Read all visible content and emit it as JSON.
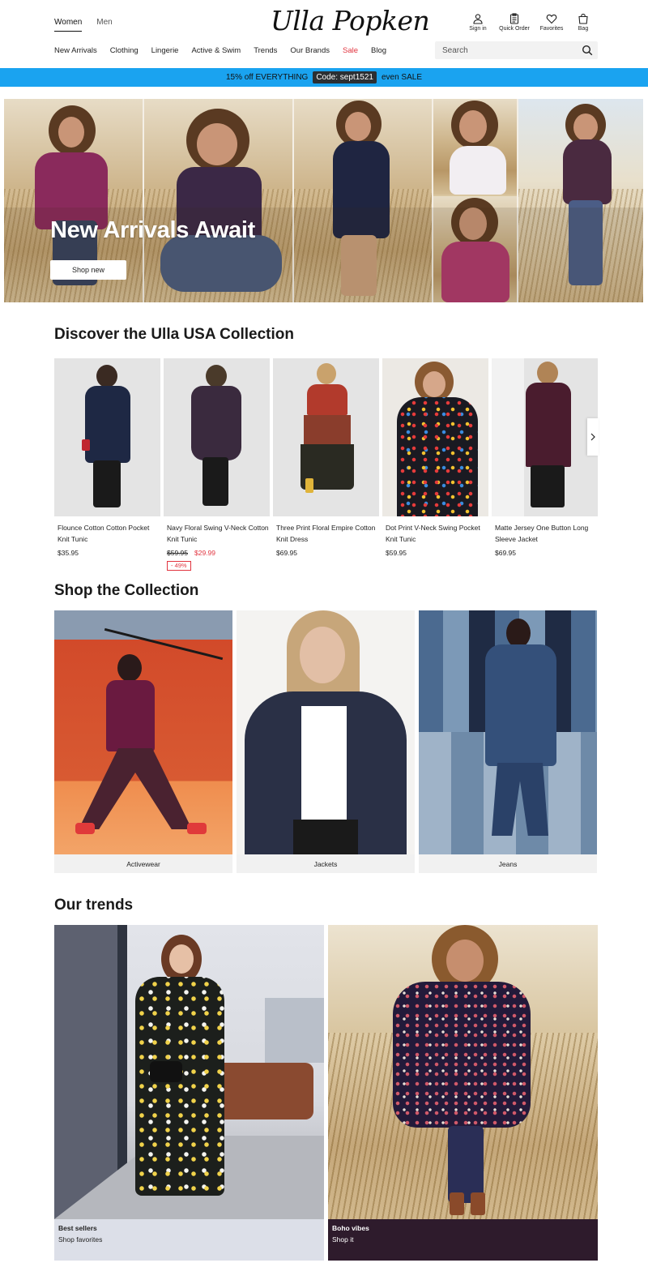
{
  "header": {
    "gender_tabs": [
      "Women",
      "Men"
    ],
    "logo_text": "Ulla Popken",
    "icons": [
      {
        "label": "Sign in",
        "icon": "user-icon"
      },
      {
        "label": "Quick Order",
        "icon": "clipboard-icon"
      },
      {
        "label": "Favorites",
        "icon": "heart-icon"
      },
      {
        "label": "Bag",
        "icon": "bag-icon"
      }
    ],
    "nav": [
      "New Arrivals",
      "Clothing",
      "Lingerie",
      "Active & Swim",
      "Trends",
      "Our Brands",
      "Sale",
      "Blog"
    ],
    "search_placeholder": "Search"
  },
  "promo": {
    "text_before": "15% off EVERYTHING",
    "code": "Code: sept1521",
    "text_after": "even SALE"
  },
  "hero": {
    "title": "New Arrivals Await",
    "button": "Shop new"
  },
  "discover": {
    "title": "Discover the Ulla USA Collection",
    "products": [
      {
        "name": "Flounce Cotton Cotton Pocket Knit Tunic",
        "price": "$35.95"
      },
      {
        "name": "Navy Floral Swing V-Neck Cotton Knit Tunic",
        "price_old": "$59.95",
        "price_new": "$29.99",
        "discount": "- 49%"
      },
      {
        "name": "Three Print Floral Empire Cotton Knit Dress",
        "price": "$69.95"
      },
      {
        "name": "Dot Print V-Neck Swing Pocket Knit Tunic",
        "price": "$59.95"
      },
      {
        "name": "Matte Jersey One Button Long Sleeve Jacket",
        "price": "$69.95"
      }
    ]
  },
  "collection": {
    "title": "Shop the Collection",
    "items": [
      "Activewear",
      "Jackets",
      "Jeans"
    ]
  },
  "trends": {
    "title": "Our trends",
    "items": [
      {
        "title": "Best sellers",
        "subtitle": "Shop favorites"
      },
      {
        "title": "Boho vibes",
        "subtitle": "Shop it"
      }
    ]
  },
  "colors": {
    "promo_blue": "#1aa3f0",
    "sale_red": "#e1343f",
    "boho_caption": "#2e1b2c",
    "bestseller_caption": "#dcdfe8"
  }
}
